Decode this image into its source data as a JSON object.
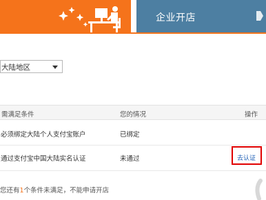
{
  "tabs": {
    "personal": {
      "illustration": "desk-workstation-icon"
    },
    "enterprise": {
      "label": "企业开店"
    }
  },
  "region": {
    "selected": "大陆地区"
  },
  "table": {
    "headers": {
      "condition": "需满足条件",
      "status": "您的情况",
      "action": "操作"
    },
    "rows": [
      {
        "condition": "必须绑定大陆个人支付宝账户",
        "status": "已绑定",
        "action": ""
      },
      {
        "condition": "通过支付宝中国大陆实名认证",
        "status": "未通过",
        "action": "去认证"
      }
    ]
  },
  "summary": {
    "prefix": "您还有",
    "count": "1",
    "suffix": "个条件未满足，不能申请开店"
  },
  "colors": {
    "accent": "#f5731b",
    "enterprise_tab": "#4d7fa2",
    "link": "#1f5fb5",
    "highlight": "#e10000"
  }
}
